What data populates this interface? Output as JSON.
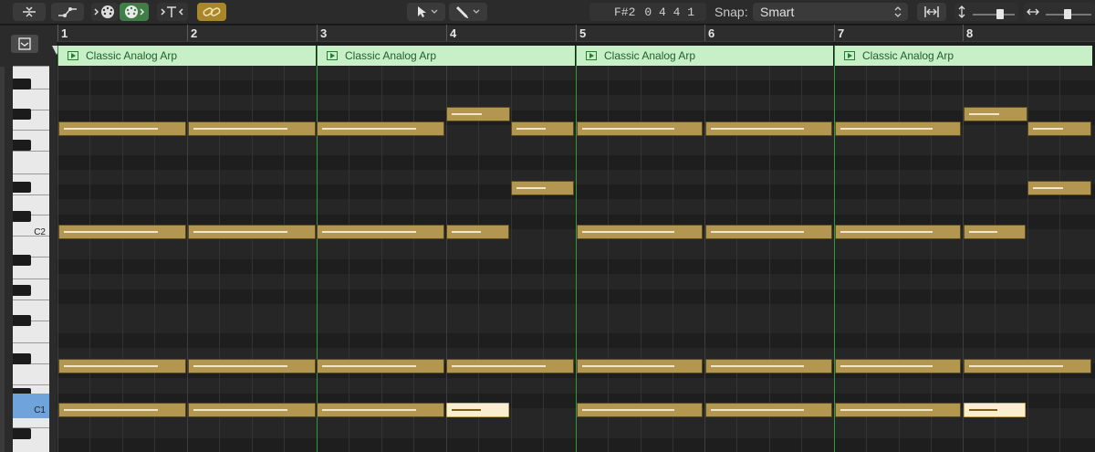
{
  "toolbar": {
    "lcd_pitch": "F#2",
    "lcd_position": "0 4 4 1",
    "snap_label": "Snap:",
    "snap_value": "Smart",
    "accent_colors": {
      "midi_out_active": "#3f7f47",
      "link_active": "#a8872a"
    }
  },
  "ruler": {
    "bars": [
      "1",
      "2",
      "3",
      "4",
      "5",
      "6",
      "7",
      "8"
    ]
  },
  "regions": [
    {
      "name": "Classic Analog Arp"
    },
    {
      "name": "Classic Analog Arp"
    },
    {
      "name": "Classic Analog Arp"
    },
    {
      "name": "Classic Analog Arp"
    }
  ],
  "keyboard": {
    "labels": {
      "c2": "C2",
      "c1": "C1"
    }
  },
  "colors": {
    "region_header": "#c8f0c6",
    "note": "#b39650",
    "note_selected": "#f7efcf",
    "region_boundary": "#2f9a3a"
  }
}
